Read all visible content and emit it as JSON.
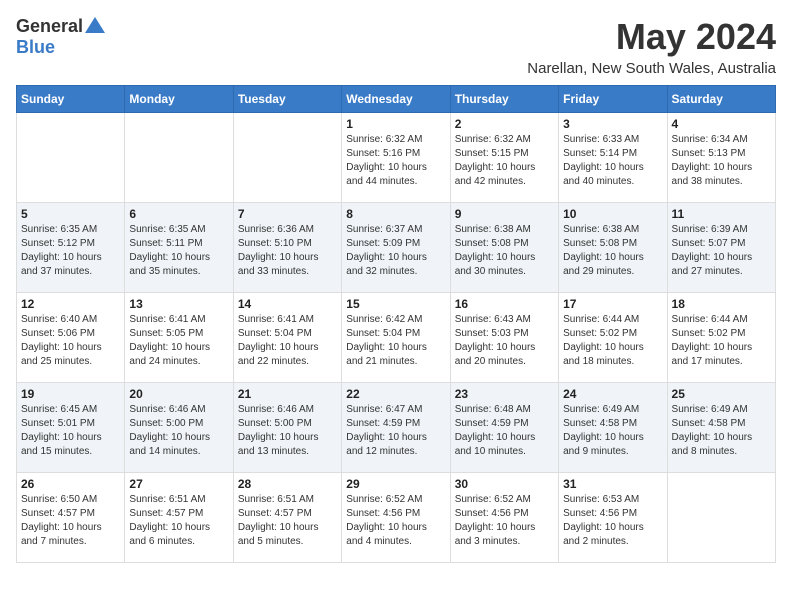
{
  "logo": {
    "general": "General",
    "blue": "Blue"
  },
  "title": "May 2024",
  "location": "Narellan, New South Wales, Australia",
  "days_header": [
    "Sunday",
    "Monday",
    "Tuesday",
    "Wednesday",
    "Thursday",
    "Friday",
    "Saturday"
  ],
  "weeks": [
    [
      {
        "day": "",
        "sunrise": "",
        "sunset": "",
        "daylight": ""
      },
      {
        "day": "",
        "sunrise": "",
        "sunset": "",
        "daylight": ""
      },
      {
        "day": "",
        "sunrise": "",
        "sunset": "",
        "daylight": ""
      },
      {
        "day": "1",
        "sunrise": "Sunrise: 6:32 AM",
        "sunset": "Sunset: 5:16 PM",
        "daylight": "Daylight: 10 hours and 44 minutes."
      },
      {
        "day": "2",
        "sunrise": "Sunrise: 6:32 AM",
        "sunset": "Sunset: 5:15 PM",
        "daylight": "Daylight: 10 hours and 42 minutes."
      },
      {
        "day": "3",
        "sunrise": "Sunrise: 6:33 AM",
        "sunset": "Sunset: 5:14 PM",
        "daylight": "Daylight: 10 hours and 40 minutes."
      },
      {
        "day": "4",
        "sunrise": "Sunrise: 6:34 AM",
        "sunset": "Sunset: 5:13 PM",
        "daylight": "Daylight: 10 hours and 38 minutes."
      }
    ],
    [
      {
        "day": "5",
        "sunrise": "Sunrise: 6:35 AM",
        "sunset": "Sunset: 5:12 PM",
        "daylight": "Daylight: 10 hours and 37 minutes."
      },
      {
        "day": "6",
        "sunrise": "Sunrise: 6:35 AM",
        "sunset": "Sunset: 5:11 PM",
        "daylight": "Daylight: 10 hours and 35 minutes."
      },
      {
        "day": "7",
        "sunrise": "Sunrise: 6:36 AM",
        "sunset": "Sunset: 5:10 PM",
        "daylight": "Daylight: 10 hours and 33 minutes."
      },
      {
        "day": "8",
        "sunrise": "Sunrise: 6:37 AM",
        "sunset": "Sunset: 5:09 PM",
        "daylight": "Daylight: 10 hours and 32 minutes."
      },
      {
        "day": "9",
        "sunrise": "Sunrise: 6:38 AM",
        "sunset": "Sunset: 5:08 PM",
        "daylight": "Daylight: 10 hours and 30 minutes."
      },
      {
        "day": "10",
        "sunrise": "Sunrise: 6:38 AM",
        "sunset": "Sunset: 5:08 PM",
        "daylight": "Daylight: 10 hours and 29 minutes."
      },
      {
        "day": "11",
        "sunrise": "Sunrise: 6:39 AM",
        "sunset": "Sunset: 5:07 PM",
        "daylight": "Daylight: 10 hours and 27 minutes."
      }
    ],
    [
      {
        "day": "12",
        "sunrise": "Sunrise: 6:40 AM",
        "sunset": "Sunset: 5:06 PM",
        "daylight": "Daylight: 10 hours and 25 minutes."
      },
      {
        "day": "13",
        "sunrise": "Sunrise: 6:41 AM",
        "sunset": "Sunset: 5:05 PM",
        "daylight": "Daylight: 10 hours and 24 minutes."
      },
      {
        "day": "14",
        "sunrise": "Sunrise: 6:41 AM",
        "sunset": "Sunset: 5:04 PM",
        "daylight": "Daylight: 10 hours and 22 minutes."
      },
      {
        "day": "15",
        "sunrise": "Sunrise: 6:42 AM",
        "sunset": "Sunset: 5:04 PM",
        "daylight": "Daylight: 10 hours and 21 minutes."
      },
      {
        "day": "16",
        "sunrise": "Sunrise: 6:43 AM",
        "sunset": "Sunset: 5:03 PM",
        "daylight": "Daylight: 10 hours and 20 minutes."
      },
      {
        "day": "17",
        "sunrise": "Sunrise: 6:44 AM",
        "sunset": "Sunset: 5:02 PM",
        "daylight": "Daylight: 10 hours and 18 minutes."
      },
      {
        "day": "18",
        "sunrise": "Sunrise: 6:44 AM",
        "sunset": "Sunset: 5:02 PM",
        "daylight": "Daylight: 10 hours and 17 minutes."
      }
    ],
    [
      {
        "day": "19",
        "sunrise": "Sunrise: 6:45 AM",
        "sunset": "Sunset: 5:01 PM",
        "daylight": "Daylight: 10 hours and 15 minutes."
      },
      {
        "day": "20",
        "sunrise": "Sunrise: 6:46 AM",
        "sunset": "Sunset: 5:00 PM",
        "daylight": "Daylight: 10 hours and 14 minutes."
      },
      {
        "day": "21",
        "sunrise": "Sunrise: 6:46 AM",
        "sunset": "Sunset: 5:00 PM",
        "daylight": "Daylight: 10 hours and 13 minutes."
      },
      {
        "day": "22",
        "sunrise": "Sunrise: 6:47 AM",
        "sunset": "Sunset: 4:59 PM",
        "daylight": "Daylight: 10 hours and 12 minutes."
      },
      {
        "day": "23",
        "sunrise": "Sunrise: 6:48 AM",
        "sunset": "Sunset: 4:59 PM",
        "daylight": "Daylight: 10 hours and 10 minutes."
      },
      {
        "day": "24",
        "sunrise": "Sunrise: 6:49 AM",
        "sunset": "Sunset: 4:58 PM",
        "daylight": "Daylight: 10 hours and 9 minutes."
      },
      {
        "day": "25",
        "sunrise": "Sunrise: 6:49 AM",
        "sunset": "Sunset: 4:58 PM",
        "daylight": "Daylight: 10 hours and 8 minutes."
      }
    ],
    [
      {
        "day": "26",
        "sunrise": "Sunrise: 6:50 AM",
        "sunset": "Sunset: 4:57 PM",
        "daylight": "Daylight: 10 hours and 7 minutes."
      },
      {
        "day": "27",
        "sunrise": "Sunrise: 6:51 AM",
        "sunset": "Sunset: 4:57 PM",
        "daylight": "Daylight: 10 hours and 6 minutes."
      },
      {
        "day": "28",
        "sunrise": "Sunrise: 6:51 AM",
        "sunset": "Sunset: 4:57 PM",
        "daylight": "Daylight: 10 hours and 5 minutes."
      },
      {
        "day": "29",
        "sunrise": "Sunrise: 6:52 AM",
        "sunset": "Sunset: 4:56 PM",
        "daylight": "Daylight: 10 hours and 4 minutes."
      },
      {
        "day": "30",
        "sunrise": "Sunrise: 6:52 AM",
        "sunset": "Sunset: 4:56 PM",
        "daylight": "Daylight: 10 hours and 3 minutes."
      },
      {
        "day": "31",
        "sunrise": "Sunrise: 6:53 AM",
        "sunset": "Sunset: 4:56 PM",
        "daylight": "Daylight: 10 hours and 2 minutes."
      },
      {
        "day": "",
        "sunrise": "",
        "sunset": "",
        "daylight": ""
      }
    ]
  ]
}
